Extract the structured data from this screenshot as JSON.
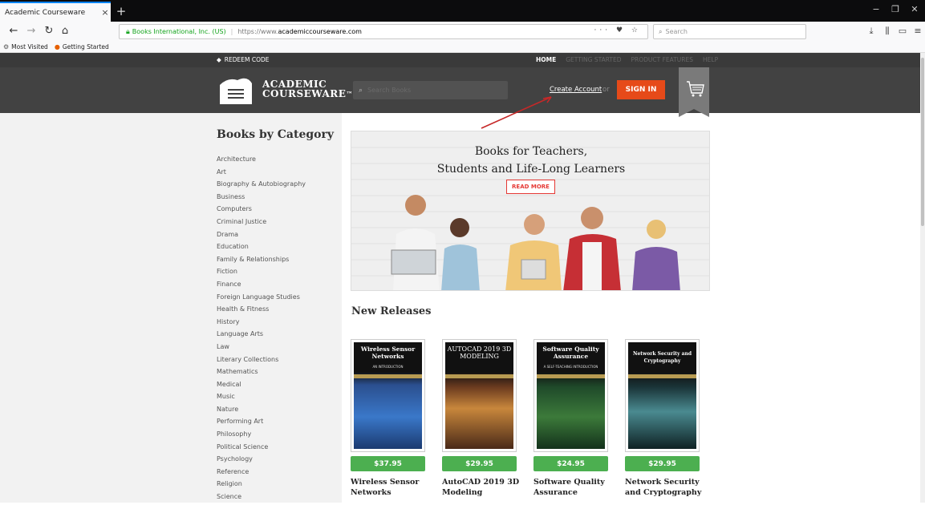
{
  "browser": {
    "tab_title": "Academic Courseware",
    "tab_close": "×",
    "new_tab": "+",
    "window_controls": [
      "−",
      "❐",
      "✕"
    ],
    "url_org": "Books International, Inc. (US)",
    "url_prefix": "https://www.",
    "url_domain": "academiccourseware.com",
    "page_actions": "··· ♥ ☆",
    "search_placeholder": "Search",
    "bookmarks": [
      "Most Visited",
      "Getting Started"
    ]
  },
  "site": {
    "redeem_label": "REDEEM CODE",
    "top_nav": [
      "HOME",
      "GETTING STARTED",
      "PRODUCT FEATURES",
      "HELP"
    ],
    "logo_line1": "ACADEMIC",
    "logo_line2": "COURSEWARE",
    "logo_tm": "™",
    "search_placeholder": "Search Books",
    "create_account": "Create Account",
    "create_sep": "or",
    "sign_in": "SIGN IN"
  },
  "sidebar": {
    "title": "Books by Category",
    "categories": [
      "Architecture",
      "Art",
      "Biography & Autobiography",
      "Business",
      "Computers",
      "Criminal Justice",
      "Drama",
      "Education",
      "Family & Relationships",
      "Fiction",
      "Finance",
      "Foreign Language Studies",
      "Health & Fitness",
      "History",
      "Language Arts",
      "Law",
      "Literary Collections",
      "Mathematics",
      "Medical",
      "Music",
      "Nature",
      "Performing Art",
      "Philosophy",
      "Political Science",
      "Psychology",
      "Reference",
      "Religion",
      "Science"
    ]
  },
  "hero": {
    "line1": "Books for Teachers,",
    "line2": "Students and Life-Long Learners",
    "button": "READ MORE"
  },
  "new_releases": {
    "title": "New Releases",
    "books": [
      {
        "cover_title": "Wireless Sensor Networks",
        "cover_sub": "AN INTRODUCTION",
        "price": "$37.95",
        "title_line1": "Wireless Sensor",
        "title_line2": "Networks"
      },
      {
        "cover_title": "AUTOCAD 2019 3D MODELING",
        "cover_sub": "",
        "price": "$29.95",
        "title_line1": "AutoCAD 2019 3D",
        "title_line2": "Modeling"
      },
      {
        "cover_title": "Software Quality Assurance",
        "cover_sub": "A SELF-TEACHING INTRODUCTION",
        "price": "$24.95",
        "title_line1": "Software Quality",
        "title_line2": "Assurance"
      },
      {
        "cover_title": "Network Security and Cryptography",
        "cover_sub": "",
        "price": "$29.95",
        "title_line1": "Network Security",
        "title_line2": "and Cryptography"
      }
    ]
  },
  "colors": {
    "header_bg": "#424242",
    "signin": "#e64a19",
    "price": "#4caf50",
    "annotation_arrow": "#c62828"
  }
}
